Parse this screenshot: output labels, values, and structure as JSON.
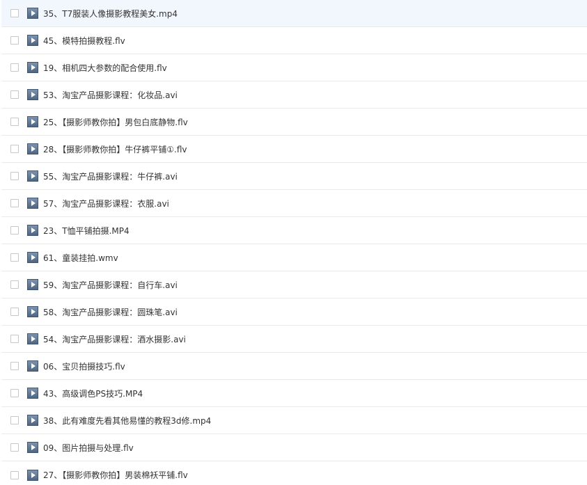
{
  "files": [
    {
      "name": "35、T7服装人像摄影教程美女.mp4"
    },
    {
      "name": "45、模特拍摄教程.flv"
    },
    {
      "name": "19、相机四大参数的配合使用.flv"
    },
    {
      "name": "53、淘宝产品摄影课程：化妆品.avi"
    },
    {
      "name": "25、【摄影师教你拍】男包白底静物.flv"
    },
    {
      "name": "28、【摄影师教你拍】牛仔裤平铺①.flv"
    },
    {
      "name": "55、淘宝产品摄影课程：牛仔裤.avi"
    },
    {
      "name": "57、淘宝产品摄影课程：衣服.avi"
    },
    {
      "name": "23、T恤平铺拍摄.MP4"
    },
    {
      "name": "61、童装挂拍.wmv"
    },
    {
      "name": "59、淘宝产品摄影课程：自行车.avi"
    },
    {
      "name": "58、淘宝产品摄影课程：圆珠笔.avi"
    },
    {
      "name": "54、淘宝产品摄影课程：酒水摄影.avi"
    },
    {
      "name": "06、宝贝拍摄技巧.flv"
    },
    {
      "name": "43、高级调色PS技巧.MP4"
    },
    {
      "name": "38、此有难度先看其他易懂的教程3d修.mp4"
    },
    {
      "name": "09、图片拍摄与处理.flv"
    },
    {
      "name": "27、【摄影师教你拍】男装棉袄平铺.flv"
    }
  ],
  "icons": {
    "checkbox": "checkbox",
    "file": "video-file-icon"
  },
  "colors": {
    "highlight_row": "#f2f6fd",
    "row_divider": "#eaeaea",
    "text": "#333333",
    "icon": "#5a708a"
  }
}
